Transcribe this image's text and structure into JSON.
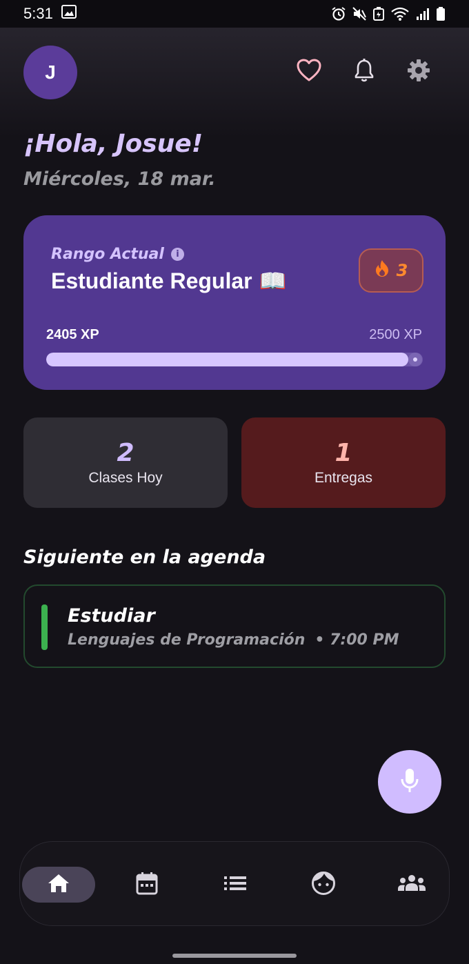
{
  "status_bar": {
    "time": "5:31"
  },
  "header": {
    "avatar_initial": "J"
  },
  "greeting": {
    "hello": "¡Hola, Josue!",
    "date": "Miércoles, 18 mar."
  },
  "rank": {
    "label": "Rango Actual",
    "info_glyph": "i",
    "title": "Estudiante Regular",
    "title_emoji": "📖",
    "streak_count": "3",
    "xp_current": "2405 XP",
    "xp_max": "2500 XP",
    "xp_progress_fraction": 0.962
  },
  "stats": [
    {
      "value": "2",
      "label": "Clases Hoy",
      "accent": "#d0bcff",
      "bg": "#2f2d34"
    },
    {
      "value": "1",
      "label": "Entregas",
      "accent": "#ffb4ab",
      "bg": "#551b1d"
    }
  ],
  "agenda": {
    "title": "Siguiente en la agenda",
    "item": {
      "name": "Estudiar",
      "subject": "Lenguajes de Programación",
      "time": "• 7:00 PM",
      "accent": "#3cb14f"
    }
  },
  "nav": {
    "items": [
      {
        "icon": "home-icon",
        "active": true
      },
      {
        "icon": "calendar-icon",
        "active": false
      },
      {
        "icon": "list-icon",
        "active": false
      },
      {
        "icon": "face-icon",
        "active": false
      },
      {
        "icon": "group-icon",
        "active": false
      }
    ]
  },
  "colors": {
    "background": "#141218",
    "primary": "#d0bcff",
    "rank_card": "#523891",
    "favorite": "#ffb4c2"
  }
}
